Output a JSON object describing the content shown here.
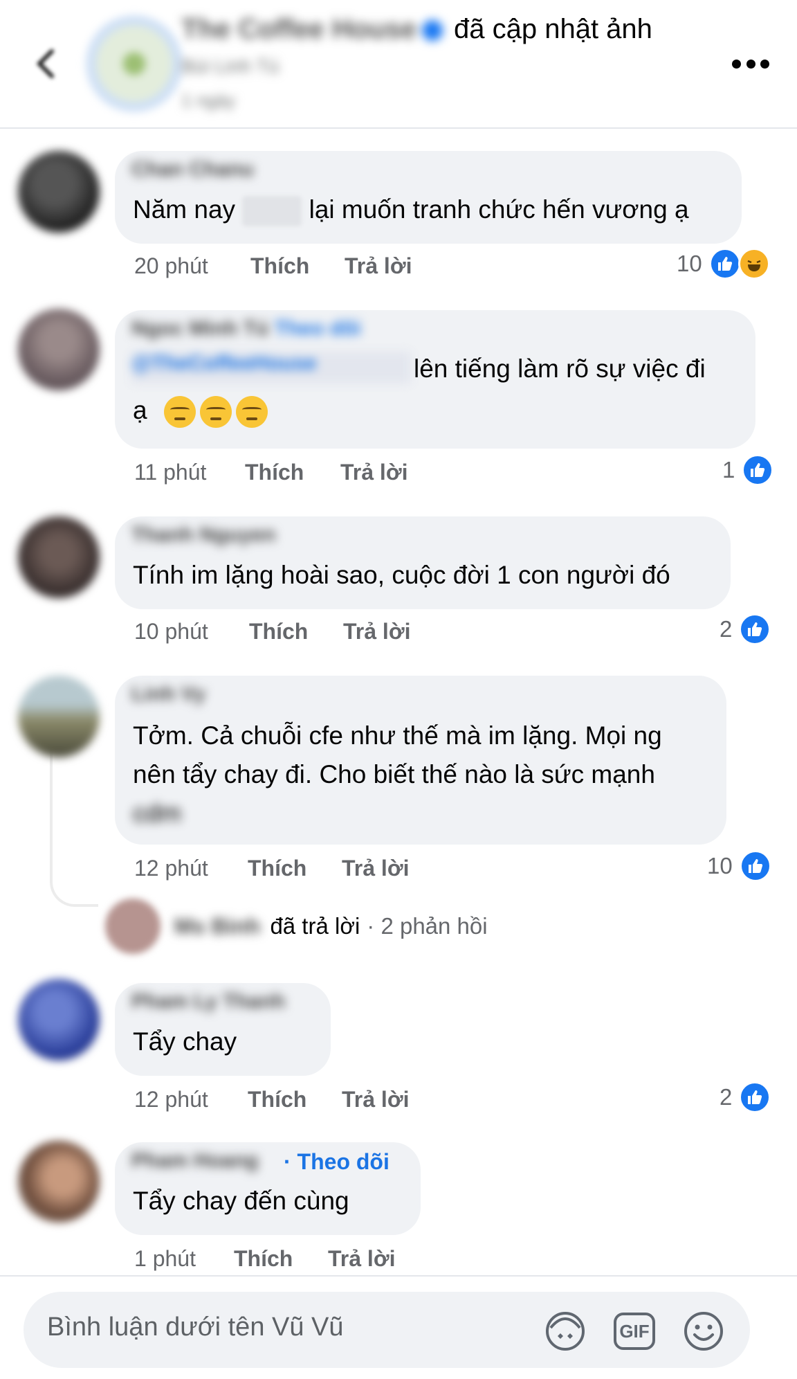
{
  "header": {
    "page_name": "The Coffee House",
    "action_text": "đã cập nhật ảnh",
    "subtitle": "Bùi Linh Tú",
    "time": "1 ngày"
  },
  "comments": [
    {
      "author": "Chan Chanu",
      "text_before": "Năm nay",
      "text_after": "lại muốn tranh chức hến vương ạ",
      "time": "20 phút",
      "like_label": "Thích",
      "reply_label": "Trả lời",
      "reaction_count": "10"
    },
    {
      "author": "Ngoc Minh Tú",
      "follow_link": "Theo dõi",
      "mention": "@TheCoffeeHouse",
      "text_line1": "lên tiếng làm rõ sự việc đi",
      "text_line2": "ạ",
      "time": "11 phút",
      "like_label": "Thích",
      "reply_label": "Trả lời",
      "reaction_count": "1"
    },
    {
      "author": "Thanh Nguyen",
      "text": "Tính im lặng hoài sao, cuộc đời 1 con người đó",
      "time": "10 phút",
      "like_label": "Thích",
      "reply_label": "Trả lời",
      "reaction_count": "2"
    },
    {
      "author": "Linh Vy",
      "text_line1": "Tởm. Cả chuỗi cfe như thế mà im lặng. Mọi ng",
      "text_line2": "nên tẩy chay đi. Cho biết thế nào là sức mạnh",
      "text_line3": "cdm",
      "time": "12 phút",
      "like_label": "Thích",
      "reply_label": "Trả lời",
      "reaction_count": "10",
      "reply_summary": {
        "name": "Ms Binh",
        "text": "đã trả lời",
        "count": "· 2 phản hồi"
      }
    },
    {
      "author": "Pham Ly Thanh",
      "text": "Tẩy chay",
      "time": "12 phút",
      "like_label": "Thích",
      "reply_label": "Trả lời",
      "reaction_count": "2"
    },
    {
      "author": "Pham Hoang",
      "follow_link": "· Theo dõi",
      "text": "Tẩy chay đến cùng",
      "time": "1 phút",
      "like_label": "Thích",
      "reply_label": "Trả lời"
    }
  ],
  "composer": {
    "placeholder": "Bình luận dưới tên Vũ Vũ",
    "gif_label": "GIF"
  },
  "colors": {
    "bubble": "#f0f2f5",
    "meta_text": "#65676b",
    "like_blue": "#1877f2",
    "follow_blue": "#1b74e4"
  }
}
